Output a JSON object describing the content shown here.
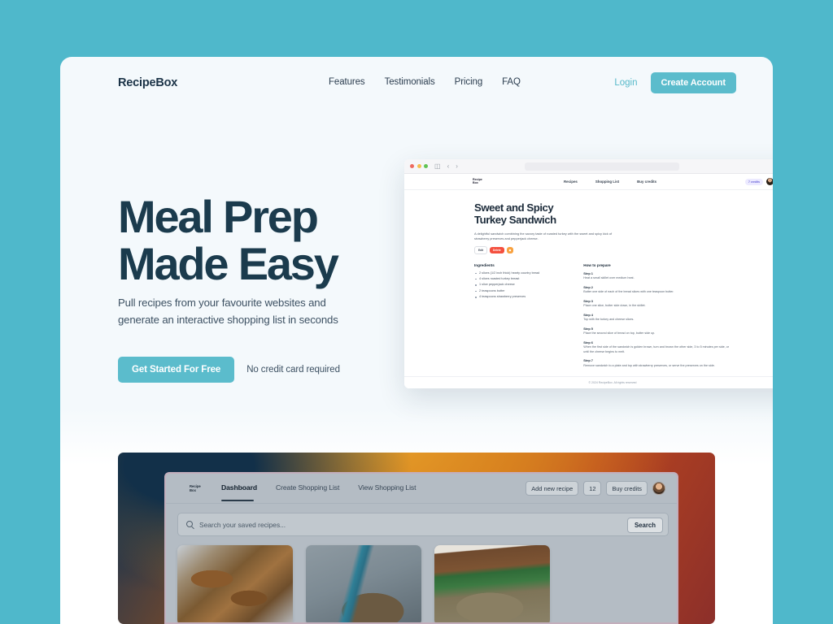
{
  "navbar": {
    "brand": "RecipeBox",
    "links": [
      "Features",
      "Testimonials",
      "Pricing",
      "FAQ"
    ],
    "login_label": "Login",
    "create_account_label": "Create Account"
  },
  "hero": {
    "title": "Meal Prep\nMade Easy",
    "subtitle": "Pull recipes from your favourite websites and generate an interactive shopping list in seconds",
    "cta_label": "Get Started For Free",
    "cta_note": "No credit card required"
  },
  "mockup": {
    "nav": {
      "logo": "Recipe\nBox",
      "links": [
        "Recipes",
        "Shopping List",
        "Buy credits"
      ],
      "credits_badge": "7 credits"
    },
    "recipe": {
      "title": "Sweet and Spicy\nTurkey Sandwich",
      "description": "A delightful sandwich combining the savory taste of roasted turkey with the sweet and spicy kick of strawberry preserves and pepperjack cheese.",
      "badges": [
        "Edit",
        "Delete",
        "☗"
      ],
      "ingredients_heading": "Ingredients",
      "ingredients": [
        "2 slices (1/2 inch thick) hearty country bread",
        "4 slices roasted turkey breast",
        "1 slice pepperjack cheese",
        "2 teaspoons butter",
        "4 teaspoons strawberry preserves"
      ],
      "steps_heading": "How to prepare",
      "steps": [
        {
          "label": "Step 1",
          "text": "Heat a small skillet over medium heat."
        },
        {
          "label": "Step 2",
          "text": "Butter one side of each of the bread slices with one teaspoon butter."
        },
        {
          "label": "Step 3",
          "text": "Place one slice, butter side down, in the skillet."
        },
        {
          "label": "Step 4",
          "text": "Top with the turkey and cheese slices."
        },
        {
          "label": "Step 5",
          "text": "Place the second slice of bread on top, butter side up."
        },
        {
          "label": "Step 6",
          "text": "When the first side of the sandwich is golden brown, turn and brown the other side, 3 to 5 minutes per side, or until the cheese begins to melt."
        },
        {
          "label": "Step 7",
          "text": "Remove sandwich to a plate and top with strawberry preserves, or serve the preserves on the side."
        }
      ]
    },
    "footer": "© 2024 RecipeBox. All rights reserved"
  },
  "dashboard": {
    "logo": "Recipe\nBox",
    "links": [
      "Dashboard",
      "Create Shopping List",
      "View Shopping List"
    ],
    "active_link": "Dashboard",
    "add_recipe_label": "Add new recipe",
    "credits_count": "12",
    "buy_credits_label": "Buy credits",
    "search_placeholder": "Search your saved recipes...",
    "search_button_label": "Search",
    "cards": [
      "recipe-photo-skewers",
      "recipe-photo-bowl",
      "recipe-photo-greens"
    ]
  },
  "colors": {
    "background": "#4fb8cb",
    "card": "#f4f9fc",
    "accent": "#5bbccc",
    "heading": "#1b3b4d"
  }
}
